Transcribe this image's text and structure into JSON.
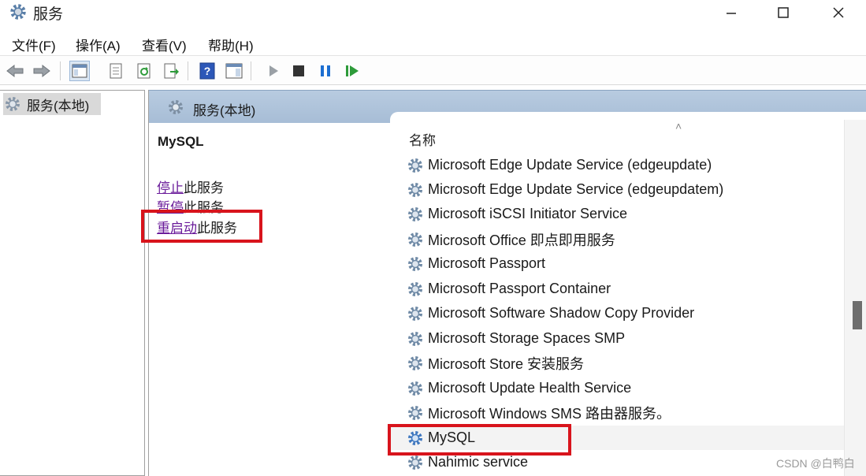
{
  "window": {
    "title": "服务"
  },
  "menu": [
    "文件(F)",
    "操作(A)",
    "查看(V)",
    "帮助(H)"
  ],
  "toolbar": {
    "buttons": [
      "back-icon",
      "forward-icon",
      "show-console-tree-icon",
      "properties-icon",
      "refresh-icon",
      "export-list-icon",
      "help-icon",
      "show-action-pane-icon",
      "start-service-icon",
      "stop-service-icon",
      "pause-service-icon",
      "restart-service-icon"
    ]
  },
  "tree": {
    "item": "服务(本地)"
  },
  "pane": {
    "header": "服务(本地)"
  },
  "description": {
    "service_name": "MySQL",
    "actions": [
      {
        "link": "停止",
        "text": "此服务"
      },
      {
        "link": "暂停",
        "text": "此服务"
      },
      {
        "link": "重启动",
        "text": "此服务"
      }
    ]
  },
  "list": {
    "column_name": "名称",
    "sort_indicator": "˄",
    "rows": [
      "Microsoft Edge Update Service (edgeupdate)",
      "Microsoft Edge Update Service (edgeupdatem)",
      "Microsoft iSCSI Initiator Service",
      "Microsoft Office 即点即用服务",
      "Microsoft Passport",
      "Microsoft Passport Container",
      "Microsoft Software Shadow Copy Provider",
      "Microsoft Storage Spaces SMP",
      "Microsoft Store 安装服务",
      "Microsoft Update Health Service",
      "Microsoft Windows SMS 路由器服务。",
      "MySQL",
      "Nahimic service"
    ],
    "selected": "MySQL"
  },
  "watermark": "CSDN @白鸭白",
  "colors": {
    "highlight_box": "#d8141c",
    "link": "#6a1b9a",
    "header_bg": "#a7bdd6"
  }
}
